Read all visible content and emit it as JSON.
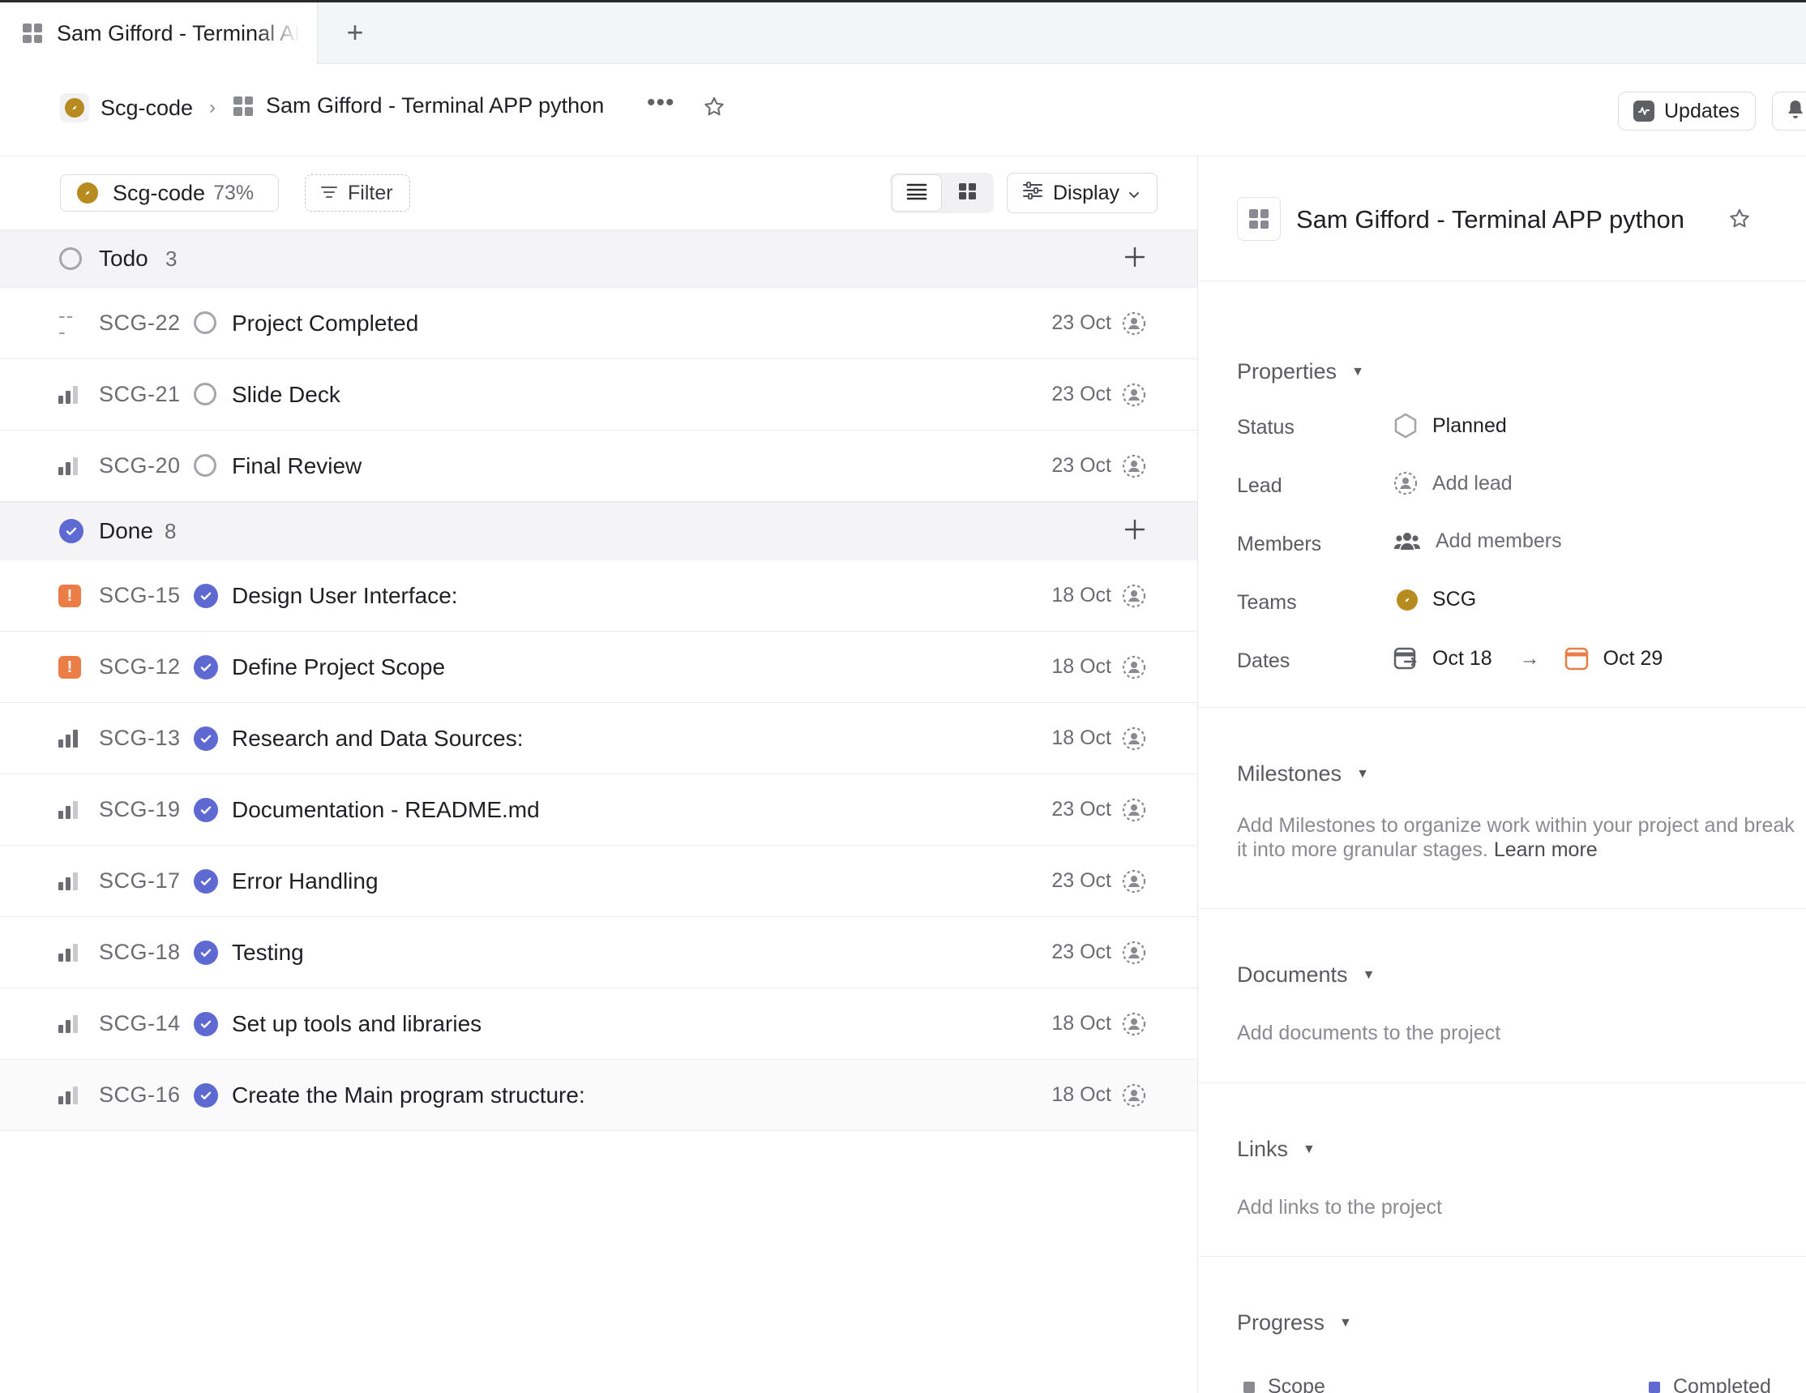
{
  "tab": {
    "title": "Sam Gifford - Terminal APP python",
    "new_tab_label": "+"
  },
  "breadcrumb": {
    "team": "Scg-code",
    "separator": "›",
    "project": "Sam Gifford - Terminal APP python"
  },
  "header": {
    "more_label": "•••",
    "updates_label": "Updates"
  },
  "toolbar": {
    "team_chip": "Scg-code",
    "team_percent": "73%",
    "filter_label": "Filter",
    "display_label": "Display"
  },
  "groups": [
    {
      "name": "Todo",
      "count": "3",
      "issues": [
        {
          "id": "SCG-22",
          "title": "Project Completed",
          "date": "23 Oct",
          "priority": "none",
          "status": "todo"
        },
        {
          "id": "SCG-21",
          "title": "Slide Deck",
          "date": "23 Oct",
          "priority": "medium",
          "status": "todo"
        },
        {
          "id": "SCG-20",
          "title": "Final Review",
          "date": "23 Oct",
          "priority": "medium",
          "status": "todo"
        }
      ]
    },
    {
      "name": "Done",
      "count": "8",
      "issues": [
        {
          "id": "SCG-15",
          "title": "Design User Interface:",
          "date": "18 Oct",
          "priority": "urgent",
          "status": "done"
        },
        {
          "id": "SCG-12",
          "title": "Define Project Scope",
          "date": "18 Oct",
          "priority": "urgent",
          "status": "done"
        },
        {
          "id": "SCG-13",
          "title": "Research and Data Sources:",
          "date": "18 Oct",
          "priority": "high",
          "status": "done"
        },
        {
          "id": "SCG-19",
          "title": "Documentation - README.md",
          "date": "23 Oct",
          "priority": "medium",
          "status": "done"
        },
        {
          "id": "SCG-17",
          "title": "Error Handling",
          "date": "23 Oct",
          "priority": "medium",
          "status": "done"
        },
        {
          "id": "SCG-18",
          "title": "Testing",
          "date": "23 Oct",
          "priority": "medium",
          "status": "done"
        },
        {
          "id": "SCG-14",
          "title": "Set up tools and libraries",
          "date": "18 Oct",
          "priority": "medium",
          "status": "done"
        },
        {
          "id": "SCG-16",
          "title": "Create the Main program structure:",
          "date": "18 Oct",
          "priority": "medium",
          "status": "done"
        }
      ]
    }
  ],
  "details": {
    "title": "Sam Gifford - Terminal APP python",
    "properties": {
      "heading": "Properties",
      "status_label": "Status",
      "status_value": "Planned",
      "lead_label": "Lead",
      "lead_value": "Add lead",
      "members_label": "Members",
      "members_value": "Add members",
      "teams_label": "Teams",
      "teams_value": "SCG",
      "dates_label": "Dates",
      "start_date": "Oct 18",
      "arrow": "→",
      "target_date": "Oct 29"
    },
    "milestones": {
      "heading": "Milestones",
      "text": "Add Milestones to organize work within your project and break it into more granular stages.",
      "learn_more": "Learn more"
    },
    "documents": {
      "heading": "Documents",
      "text": "Add documents to the project"
    },
    "links": {
      "heading": "Links",
      "text": "Add links to the project"
    },
    "progress": {
      "heading": "Progress",
      "scope_label": "Scope",
      "completed_label": "Completed"
    }
  },
  "colors": {
    "accent": "#5e6ad2",
    "urgent": "#eb7d46",
    "team": "#b78b20",
    "date_target": "#eb7d46"
  }
}
